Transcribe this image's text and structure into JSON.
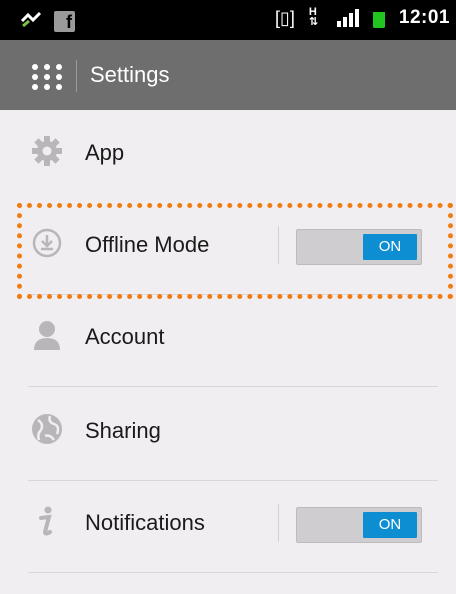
{
  "status_bar": {
    "time": "12:01",
    "icons": [
      "usb-debug-icon",
      "facebook-icon",
      "vibrate-icon",
      "hspa-icon",
      "signal-icon",
      "battery-icon"
    ],
    "fb_letter": "f",
    "vibrate_glyph": "[▯]",
    "hspa_top": "H",
    "hspa_bottom": "⇅"
  },
  "action_bar": {
    "title": "Settings",
    "icon": "apps-grid-icon"
  },
  "settings": {
    "items": [
      {
        "label": "App",
        "icon": "gear-icon"
      },
      {
        "label": "Offline Mode",
        "icon": "download-icon",
        "toggle": "ON"
      },
      {
        "label": "Account",
        "icon": "person-icon"
      },
      {
        "label": "Sharing",
        "icon": "globe-icon"
      },
      {
        "label": "Notifications",
        "icon": "info-icon",
        "toggle": "ON"
      }
    ]
  },
  "colors": {
    "toggle_on": "#0e8ed2",
    "highlight": "#f07c12",
    "action_bar": "#6e6e6e"
  }
}
